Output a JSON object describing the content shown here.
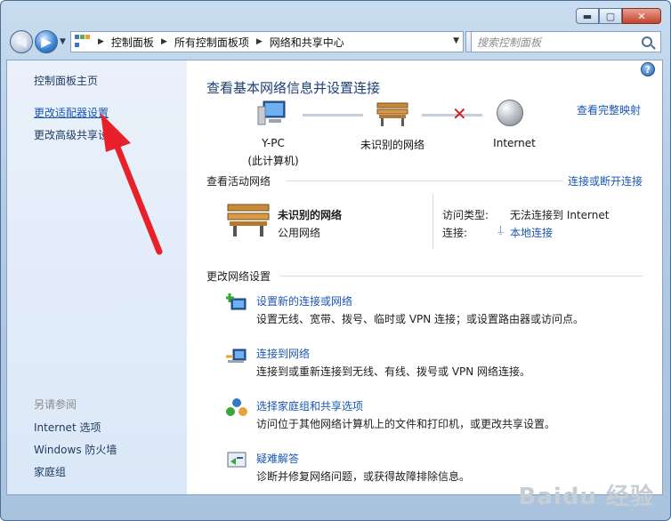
{
  "window": {
    "controls": {
      "min": "▬",
      "max": "▢",
      "close": "✕"
    }
  },
  "navbar": {
    "breadcrumbs": [
      "控制面板",
      "所有控制面板项",
      "网络和共享中心"
    ],
    "search_placeholder": "搜索控制面板"
  },
  "sidebar": {
    "home": "控制面板主页",
    "links": [
      "更改适配器设置",
      "更改高级共享设置"
    ],
    "see_also_title": "另请参阅",
    "see_also": [
      "Internet 选项",
      "Windows 防火墙",
      "家庭组"
    ]
  },
  "main": {
    "title": "查看基本网络信息并设置连接",
    "full_map_link": "查看完整映射",
    "help": "?",
    "map": {
      "pc_name": "Y-PC",
      "pc_sub": "(此计算机)",
      "network": "未识别的网络",
      "internet": "Internet"
    },
    "active_section": "查看活动网络",
    "connect_link": "连接或断开连接",
    "active": {
      "name": "未识别的网络",
      "type": "公用网络",
      "access_label": "访问类型:",
      "access_value": "无法连接到 Internet",
      "conn_label": "连接:",
      "conn_value": "本地连接"
    },
    "change_section": "更改网络设置",
    "tasks": [
      {
        "title": "设置新的连接或网络",
        "desc": "设置无线、宽带、拨号、临时或 VPN 连接；或设置路由器或访问点。",
        "icon": "new-connection-icon"
      },
      {
        "title": "连接到网络",
        "desc": "连接到或重新连接到无线、有线、拨号或 VPN 网络连接。",
        "icon": "connect-network-icon"
      },
      {
        "title": "选择家庭组和共享选项",
        "desc": "访问位于其他网络计算机上的文件和打印机，或更改共享设置。",
        "icon": "homegroup-icon"
      },
      {
        "title": "疑难解答",
        "desc": "诊断并修复网络问题，或获得故障排除信息。",
        "icon": "troubleshoot-icon"
      }
    ]
  },
  "watermark": "Baidu 经验",
  "colors": {
    "link": "#1a57b6",
    "title": "#1b3f7a",
    "arrow": "#e8202a"
  }
}
